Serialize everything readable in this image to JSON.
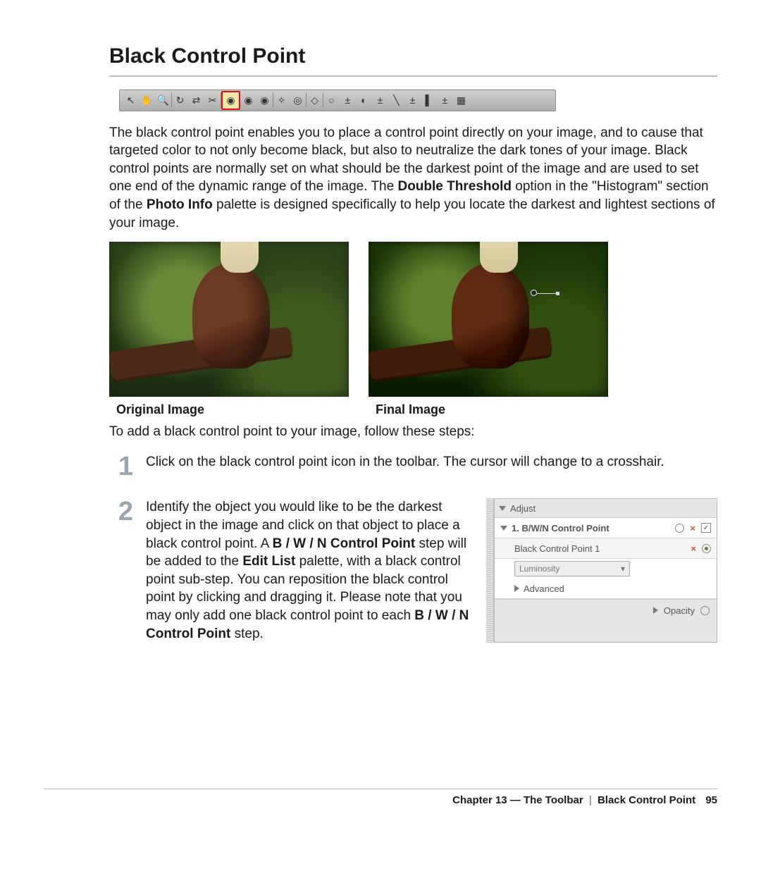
{
  "title": "Black Control Point",
  "intro_parts": {
    "a": "The black control point enables you to place a control point directly on your image, and to cause that targeted color to not only become black, but also to neutralize the dark tones of your image. Black control points are normally set on what should be the darkest point of the image and are used to set one end of the dynamic range of the image. The ",
    "b": "Double Threshold",
    "c": " option in the \"Histogram\" section of the ",
    "d": "Photo Info",
    "e": " palette is designed specifically to help you locate the darkest and lightest sections of your image."
  },
  "captions": {
    "original": "Original Image",
    "final": "Final Image"
  },
  "intro2": "To add a black control point to your image, follow these steps:",
  "steps": [
    {
      "n": "1",
      "text": "Click on the black control point icon in the toolbar. The cursor will change to a crosshair."
    },
    {
      "n": "2",
      "pre": "Identify the object you would like to be the darkest object in the image and click on that object to place a black control point. A ",
      "b1": "B / W / N Control Point",
      "mid1": " step will be added to the ",
      "b2": "Edit List",
      "mid2": " palette, with a black control point sub-step. You can reposition the black control point by clicking and dragging it. Please note that you may only add one black control point to each ",
      "b3": "B / W / N Control Point",
      "post": " step."
    }
  ],
  "panel": {
    "adjust": "Adjust",
    "heading": "1. B/W/N Control Point",
    "item": "Black Control Point 1",
    "dropdown": "Luminosity",
    "advanced": "Advanced",
    "opacity": "Opacity"
  },
  "footer": {
    "chapter": "Chapter 13 — The Toolbar",
    "section": "Black Control Point",
    "page": "95"
  },
  "toolbar_icons": [
    "pointer",
    "hand",
    "zoom",
    "|",
    "rotate",
    "straighten",
    "crop",
    "|",
    "black-cp",
    "neutral-cp",
    "white-cp",
    "|",
    "auto-levels",
    "dcurve",
    "|",
    "lasso",
    "|",
    "color-cp",
    "addsub1",
    "linear-grad",
    "addsub2",
    "gradient",
    "addsub3",
    "selection-brush",
    "addsub4",
    "fill"
  ],
  "glyphs": {
    "pointer": "↖",
    "hand": "✋",
    "zoom": "🔍",
    "rotate": "↻",
    "straighten": "⇄",
    "crop": "✂",
    "black-cp": "◉",
    "neutral-cp": "◉",
    "white-cp": "◉",
    "auto-levels": "✧",
    "dcurve": "◎",
    "lasso": "◇",
    "color-cp": "○",
    "addsub1": "±",
    "linear-grad": "◐",
    "addsub2": "±",
    "gradient": "╲",
    "addsub3": "±",
    "selection-brush": "▌",
    "addsub4": "±",
    "fill": "▦"
  }
}
